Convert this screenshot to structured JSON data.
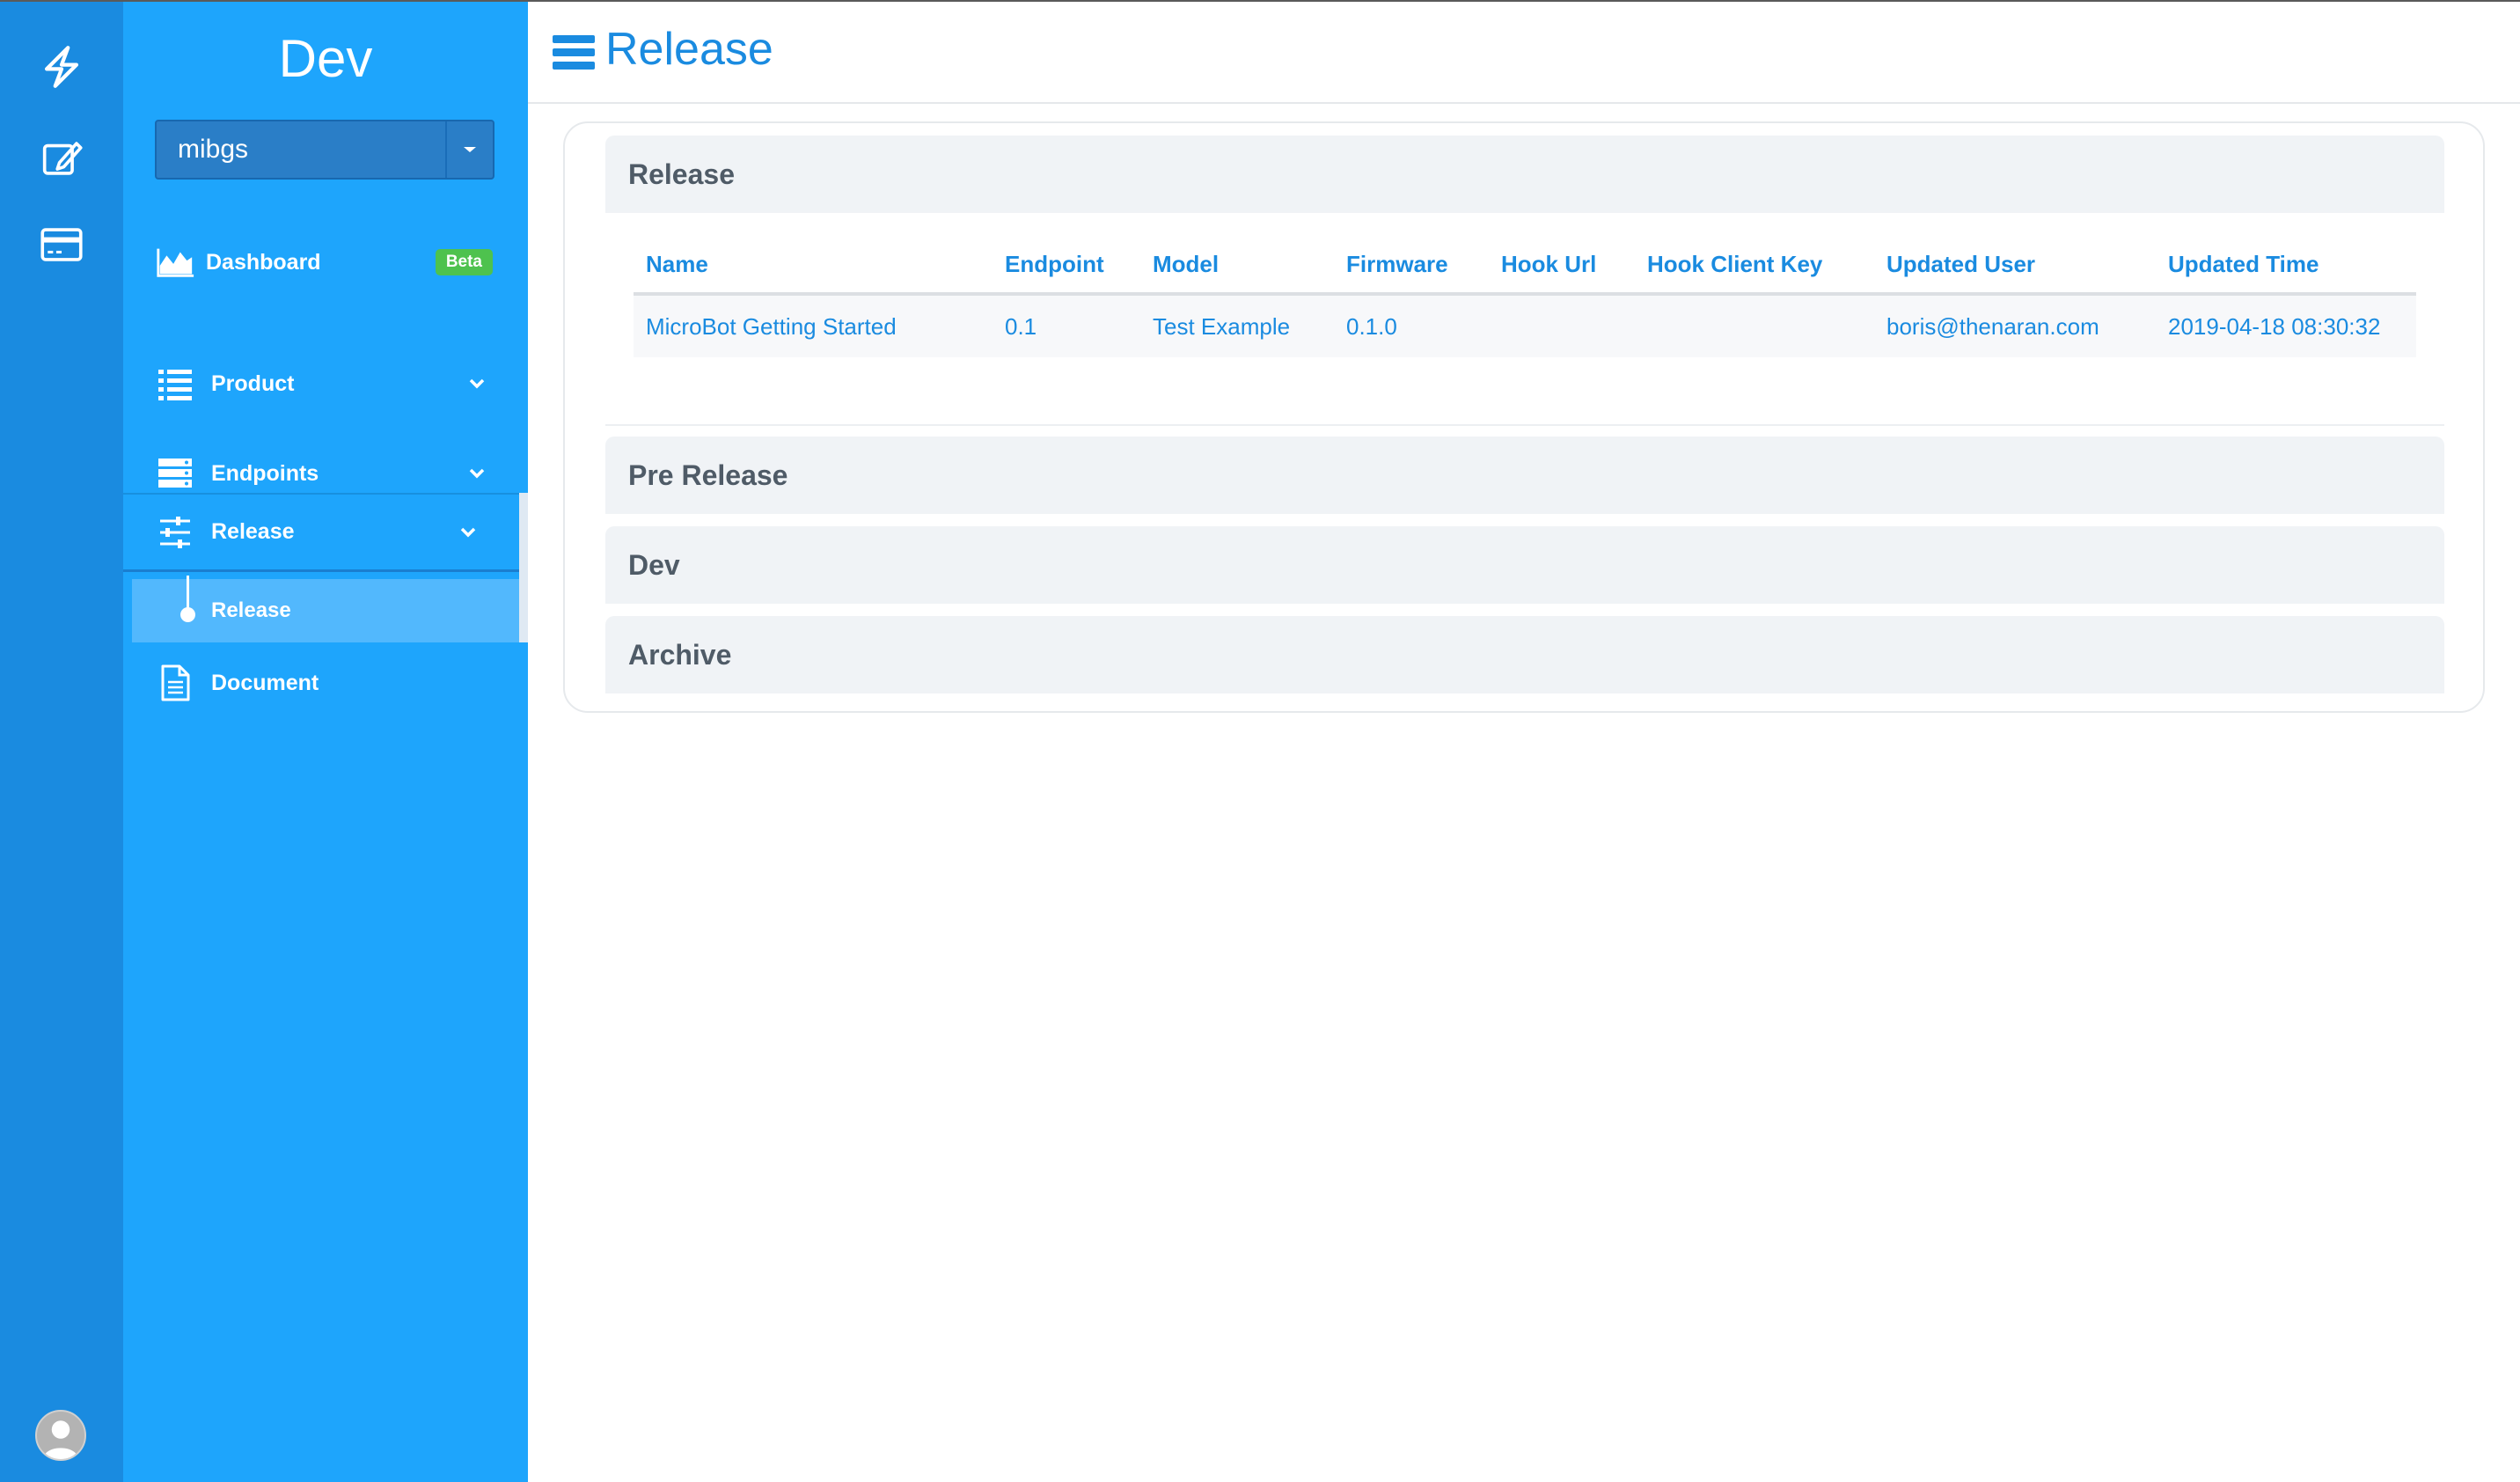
{
  "sidebar": {
    "env_title": "Dev",
    "project": "mibgs",
    "items": [
      {
        "label": "Dashboard",
        "badge": "Beta"
      },
      {
        "label": "Product"
      },
      {
        "label": "Endpoints"
      },
      {
        "label": "Release",
        "children": [
          {
            "label": "Release"
          }
        ]
      },
      {
        "label": "Document"
      }
    ]
  },
  "header": {
    "title": "Release"
  },
  "sections": {
    "release": {
      "title": "Release",
      "columns": [
        "Name",
        "Endpoint",
        "Model",
        "Firmware",
        "Hook Url",
        "Hook Client Key",
        "Updated User",
        "Updated Time"
      ],
      "rows": [
        [
          "MicroBot Getting Started",
          "0.1",
          "Test Example",
          "0.1.0",
          "",
          "",
          "boris@thenaran.com",
          "2019-04-18 08:30:32"
        ]
      ]
    },
    "pre_release": {
      "title": "Pre Release"
    },
    "dev": {
      "title": "Dev"
    },
    "archive": {
      "title": "Archive"
    }
  },
  "colors": {
    "rail": "#1a8be0",
    "sidebar": "#1ea5fc",
    "accent": "#1a8be0",
    "badge": "#4ec24e"
  }
}
